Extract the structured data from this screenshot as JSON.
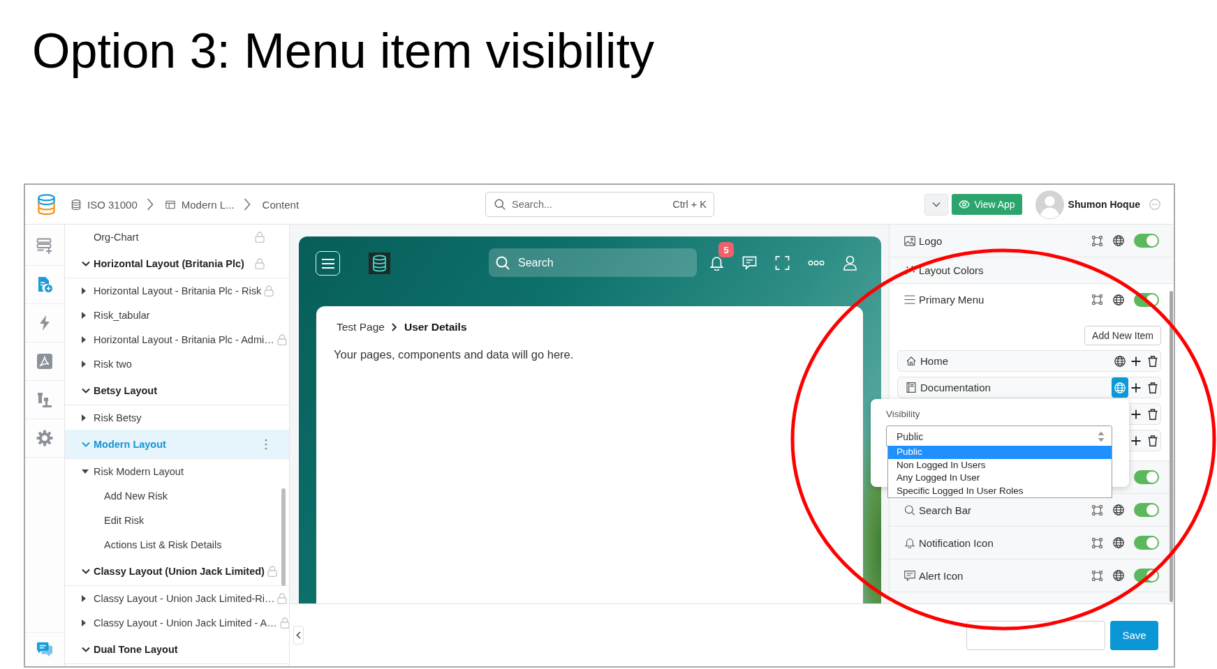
{
  "slide": {
    "title": "Option 3: Menu item visibility"
  },
  "topbar": {
    "breadcrumb": [
      {
        "label": "ISO 31000"
      },
      {
        "label": "Modern L..."
      },
      {
        "label": "Content"
      }
    ],
    "search": {
      "placeholder": "Search...",
      "shortcut": "Ctrl + K"
    },
    "view_app": "View App",
    "user": "Shumon Hoque"
  },
  "rail": {
    "items": [
      {
        "selected": false
      },
      {
        "selected": true
      },
      {
        "selected": false
      },
      {
        "selected": false
      },
      {
        "selected": false
      },
      {
        "selected": false
      }
    ]
  },
  "tree": {
    "items": [
      {
        "label": "Org-Chart",
        "kind": "page",
        "locked": true,
        "selected": false
      },
      {
        "label": "Horizontal Layout (Britania Plc)",
        "kind": "group",
        "expanded": true,
        "locked": true,
        "selected": false,
        "children": [
          {
            "label": "Horizontal Layout - Britania Plc - Risk",
            "kind": "folder",
            "expanded": false,
            "locked": true,
            "selected": false
          },
          {
            "label": "Risk_tabular",
            "kind": "folder",
            "expanded": false,
            "locked": false,
            "selected": false
          },
          {
            "label": "Horizontal Layout - Britania Plc - Admi…",
            "kind": "folder",
            "expanded": false,
            "locked": true,
            "selected": false
          },
          {
            "label": "Risk two",
            "kind": "folder",
            "expanded": false,
            "locked": false,
            "selected": false
          }
        ]
      },
      {
        "label": "Betsy Layout",
        "kind": "group",
        "expanded": true,
        "locked": false,
        "selected": false,
        "children": [
          {
            "label": "Risk Betsy",
            "kind": "folder",
            "expanded": false,
            "locked": false,
            "selected": false
          }
        ]
      },
      {
        "label": "Modern Layout",
        "kind": "group",
        "expanded": true,
        "locked": false,
        "selected": true,
        "children": [
          {
            "label": "Risk Modern Layout",
            "kind": "folder",
            "expanded": true,
            "locked": false,
            "selected": false,
            "children": [
              {
                "label": "Add New Risk",
                "kind": "page",
                "locked": false,
                "selected": false
              },
              {
                "label": "Edit Risk",
                "kind": "page",
                "locked": false,
                "selected": false
              },
              {
                "label": "Actions List & Risk Details",
                "kind": "page",
                "locked": false,
                "selected": false
              }
            ]
          }
        ]
      },
      {
        "label": "Classy Layout (Union Jack Limited)",
        "kind": "group",
        "expanded": true,
        "locked": true,
        "selected": false,
        "children": [
          {
            "label": "Classy Layout - Union Jack Limited-Ri…",
            "kind": "folder",
            "expanded": false,
            "locked": true,
            "selected": false
          },
          {
            "label": "Classy Layout - Union Jack Limited - A…",
            "kind": "folder",
            "expanded": false,
            "locked": true,
            "selected": false
          }
        ]
      },
      {
        "label": "Dual Tone Layout",
        "kind": "group",
        "expanded": true,
        "locked": false,
        "selected": false
      }
    ]
  },
  "preview": {
    "search": {
      "placeholder": "Search"
    },
    "notification_count": "5",
    "breadcrumb": [
      {
        "label": "Test Page",
        "current": false
      },
      {
        "label": "User Details",
        "current": true
      }
    ],
    "message": "Your pages, components and data will go here."
  },
  "panel": {
    "sections": [
      {
        "kind": "component",
        "label": "Logo",
        "on": true
      },
      {
        "kind": "setting",
        "label": "Layout Colors"
      },
      {
        "kind": "menu",
        "label": "Primary Menu",
        "on": true,
        "expanded": true,
        "add_button": "Add New Item",
        "items": [
          {
            "label": "Home",
            "visibility_open": false
          },
          {
            "label": "Documentation",
            "visibility_open": true
          },
          {
            "visibility_open": false
          },
          {
            "visibility_open": false
          }
        ]
      },
      {
        "kind": "component",
        "on": true
      },
      {
        "kind": "component",
        "label": "Search Bar",
        "on": true
      },
      {
        "kind": "component",
        "label": "Notification Icon",
        "on": true
      },
      {
        "kind": "component",
        "label": "Alert Icon",
        "on": true
      }
    ]
  },
  "visibility_popup": {
    "label": "Visibility",
    "value": "Public",
    "options": [
      {
        "label": "Public",
        "selected": true
      },
      {
        "label": "Non Logged In Users",
        "selected": false
      },
      {
        "label": "Any Logged In User",
        "selected": false
      },
      {
        "label": "Specific Logged In User Roles",
        "selected": false
      }
    ]
  },
  "footer": {
    "save": "Save"
  }
}
